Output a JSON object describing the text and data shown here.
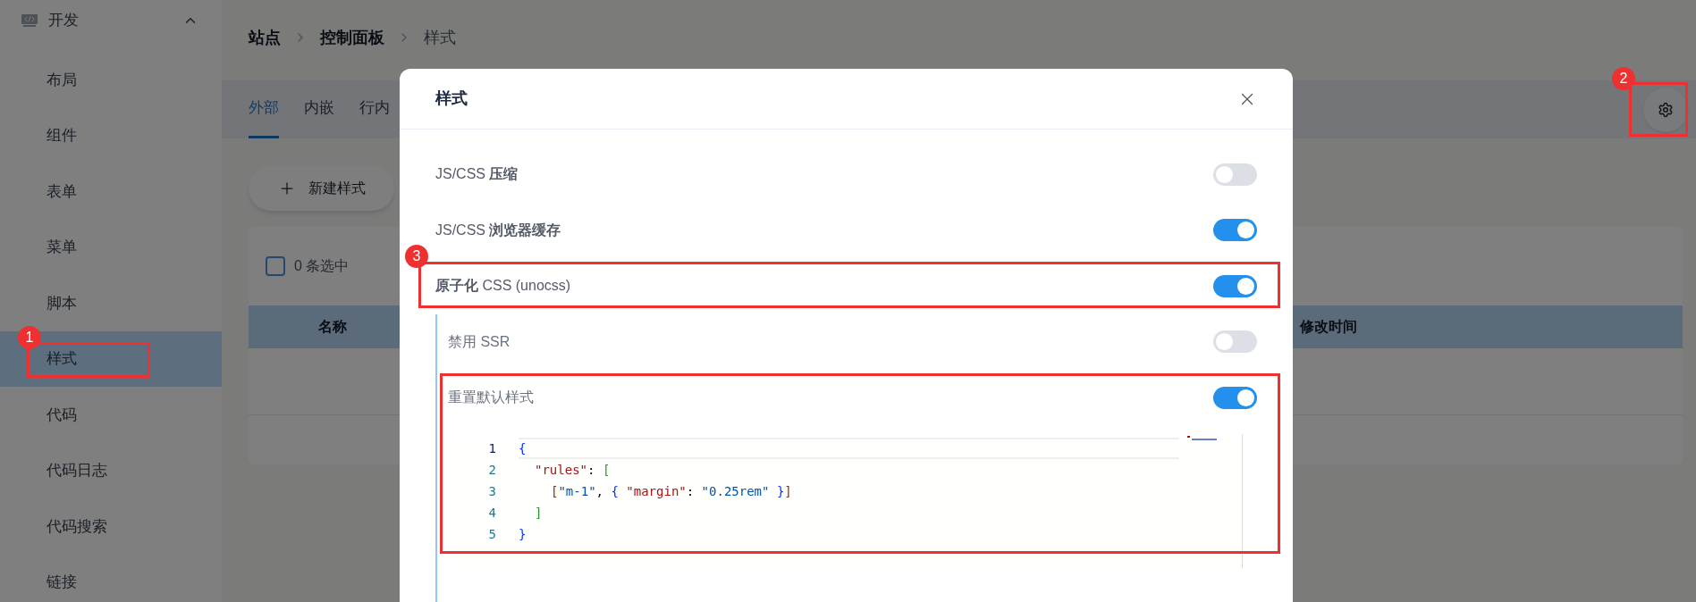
{
  "sidebar": {
    "group": {
      "label": "开发",
      "expanded": true
    },
    "items": [
      {
        "label": "布局",
        "selected": false
      },
      {
        "label": "组件",
        "selected": false
      },
      {
        "label": "表单",
        "selected": false
      },
      {
        "label": "菜单",
        "selected": false
      },
      {
        "label": "脚本",
        "selected": false
      },
      {
        "label": "样式",
        "selected": true
      },
      {
        "label": "代码",
        "selected": false
      },
      {
        "label": "代码日志",
        "selected": false
      },
      {
        "label": "代码搜索",
        "selected": false
      },
      {
        "label": "链接",
        "selected": false
      }
    ]
  },
  "breadcrumb": [
    "站点",
    "控制面板",
    "样式"
  ],
  "tabs": [
    {
      "label": "外部",
      "selected": true
    },
    {
      "label": "内嵌",
      "selected": false
    },
    {
      "label": "行内",
      "selected": false
    }
  ],
  "new_button": "新建样式",
  "table": {
    "select_all": {
      "checked": false,
      "label": "0 条选中"
    },
    "columns": [
      "名称",
      "修改时间"
    ]
  },
  "modal": {
    "title": "样式",
    "settings": [
      {
        "label": "JS/CSS **压缩**",
        "on": false
      },
      {
        "label": "JS/CSS **浏览器缓存**",
        "on": true
      },
      {
        "label": "**原子化** CSS (unocss)",
        "on": true,
        "children": [
          {
            "label": "禁用 SSR",
            "on": false
          },
          {
            "label": "重置默认样式",
            "on": true
          }
        ]
      }
    ],
    "code_editor": {
      "lines": [
        {
          "number": "1",
          "kind": "outer",
          "tokens": [
            {
              "t": "{",
              "kind": "brace"
            }
          ]
        },
        {
          "number": "2",
          "kind": "middle",
          "tokens": [
            {
              "t": "\"rules\"",
              "kind": "key"
            },
            {
              "t": ": ",
              "kind": "punct"
            },
            {
              "t": "[",
              "kind": "bracket2"
            }
          ]
        },
        {
          "number": "3",
          "kind": "inner",
          "tokens": [
            {
              "t": "[",
              "kind": "bracket3"
            },
            {
              "t": "\"m-1\"",
              "kind": "string"
            },
            {
              "t": ", ",
              "kind": "punct"
            },
            {
              "t": "{ ",
              "kind": "brace"
            },
            {
              "t": "\"margin\"",
              "kind": "key"
            },
            {
              "t": ": ",
              "kind": "punct"
            },
            {
              "t": "\"0.25rem\" ",
              "kind": "string"
            },
            {
              "t": "}",
              "kind": "brace"
            },
            {
              "t": "]",
              "kind": "bracket3"
            }
          ]
        },
        {
          "number": "4",
          "kind": "middle",
          "tokens": [
            {
              "t": "]",
              "kind": "bracket2"
            }
          ]
        },
        {
          "number": "5",
          "kind": "outer",
          "tokens": [
            {
              "t": "}",
              "kind": "brace"
            }
          ]
        }
      ]
    }
  },
  "annotations": [
    {
      "kind": "badged",
      "label": "1"
    },
    {
      "kind": "badged",
      "label": "2"
    },
    {
      "kind": "badged",
      "label": "3"
    },
    {
      "kind": "plain"
    }
  ]
}
